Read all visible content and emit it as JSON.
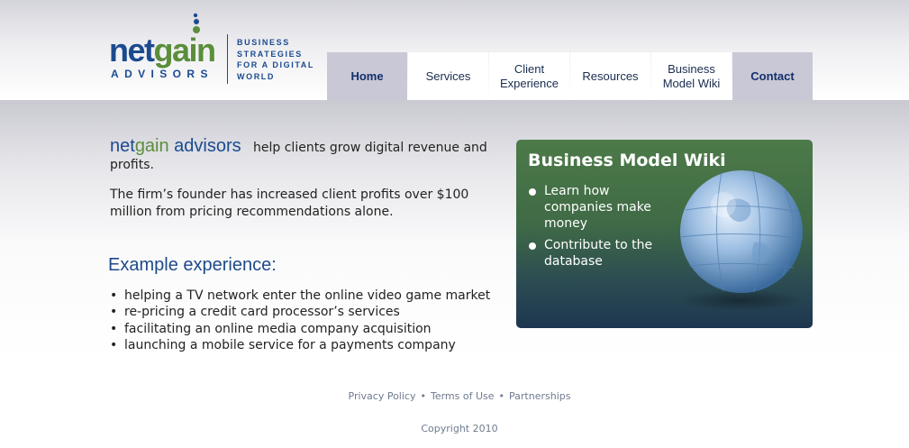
{
  "logo": {
    "net": "net",
    "gain": "gain",
    "advisors": "ADVISORS",
    "tagline": [
      "BUSINESS",
      "STRATEGIES",
      "FOR A DIGITAL",
      "WORLD"
    ]
  },
  "nav": {
    "items": [
      {
        "label": "Home",
        "active": true
      },
      {
        "label": "Services"
      },
      {
        "label_lines": [
          "Client",
          "Experience"
        ]
      },
      {
        "label": "Resources"
      },
      {
        "label_lines": [
          "Business",
          "Model Wiki"
        ]
      },
      {
        "label": "Contact",
        "active": true
      }
    ]
  },
  "intro": {
    "brand_net": "net",
    "brand_gain": "gain",
    "brand_advisors": " advisors",
    "text_after_brand": "help clients grow digital revenue and",
    "text_cont": "profits.",
    "founder": "The firm’s founder has increased client profits over $100 million from pricing recommendations alone."
  },
  "example": {
    "title": "Example experience:",
    "items": [
      "helping a TV network enter the online video game market",
      "re-pricing a credit card processor’s services",
      "facilitating an online media company acquisition",
      "launching a mobile service for a payments company"
    ]
  },
  "wiki": {
    "title": "Business Model Wiki",
    "items": [
      "Learn how companies make money",
      "Contribute to the database"
    ]
  },
  "footer": {
    "links": [
      "Privacy Policy",
      "Terms of Use",
      "Partnerships"
    ],
    "separator": "•",
    "copyright": "Copyright 2010"
  },
  "colors": {
    "brand_blue": "#1b4b8f",
    "brand_green": "#5a8e3a",
    "nav_active_bg": "#c8c8d6",
    "wiki_green": "#4d7a48"
  }
}
